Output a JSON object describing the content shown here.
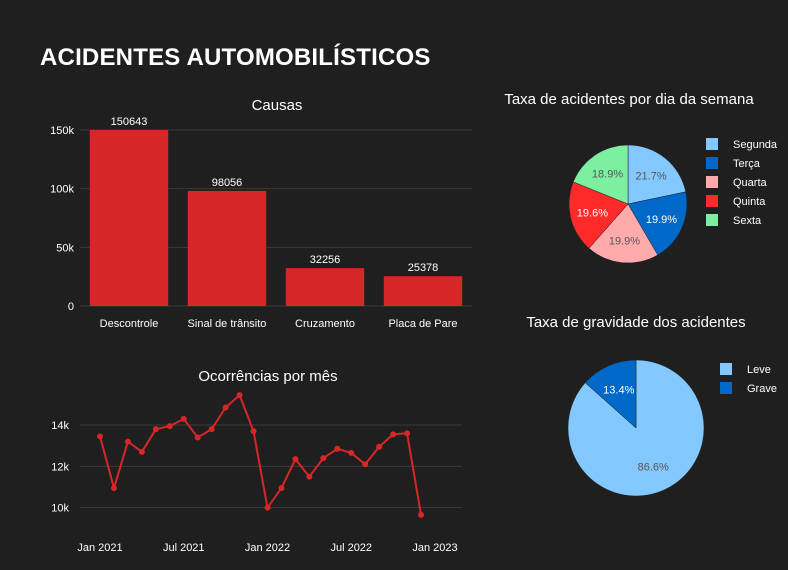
{
  "page": {
    "title": "ACIDENTES AUTOMOBILÍSTICOS"
  },
  "colors": {
    "background": "#1f1f1f",
    "bar": "#d62728",
    "line": "#d62728",
    "grid": "#3b3b3b",
    "text": "#ffffff"
  },
  "chart_data": [
    {
      "type": "bar",
      "title": "Causas",
      "categories": [
        "Descontrole",
        "Sinal de trânsito",
        "Cruzamento",
        "Placa de Pare"
      ],
      "values": [
        150643,
        98056,
        32256,
        25378
      ],
      "value_labels": [
        "150643",
        "98056",
        "32256",
        "25378"
      ],
      "ylim": [
        0,
        150000
      ],
      "yticks": [
        0,
        50000,
        100000,
        150000
      ],
      "ytick_labels": [
        "0",
        "50k",
        "100k",
        "150k"
      ],
      "grid": true
    },
    {
      "type": "line",
      "title": "Ocorrências por mês",
      "x": [
        "2021-01",
        "2021-02",
        "2021-03",
        "2021-04",
        "2021-05",
        "2021-06",
        "2021-07",
        "2021-08",
        "2021-09",
        "2021-10",
        "2021-11",
        "2021-12",
        "2022-01",
        "2022-02",
        "2022-03",
        "2022-04",
        "2022-05",
        "2022-06",
        "2022-07",
        "2022-08",
        "2022-09",
        "2022-10",
        "2022-11",
        "2022-12",
        "2023-01"
      ],
      "values": [
        13450,
        10950,
        13200,
        12700,
        13800,
        13950,
        14300,
        13400,
        13800,
        14850,
        15450,
        13700,
        10000,
        10950,
        12350,
        11500,
        12400,
        12850,
        12650,
        12100,
        12950,
        13550,
        13600,
        9650
      ],
      "xtick_labels": [
        "Jan 2021",
        "Jul 2021",
        "Jan 2022",
        "Jul 2022",
        "Jan 2023"
      ],
      "xticks": [
        "2021-01",
        "2021-07",
        "2022-01",
        "2022-07",
        "2023-01"
      ],
      "ylim": [
        9500,
        15600
      ],
      "yticks": [
        10000,
        12000,
        14000
      ],
      "ytick_labels": [
        "10k",
        "12k",
        "14k"
      ],
      "grid": true
    },
    {
      "type": "pie",
      "title": "Taxa de acidentes por dia da semana",
      "labels": [
        "Segunda",
        "Terça",
        "Quarta",
        "Quinta",
        "Sexta"
      ],
      "values": [
        21.7,
        19.9,
        19.9,
        19.6,
        18.9
      ],
      "value_labels": [
        "21.7%",
        "19.9%",
        "19.9%",
        "19.6%",
        "18.9%"
      ],
      "colors": [
        "#83c9ff",
        "#0068c9",
        "#ffabab",
        "#ff2b2b",
        "#7defa1"
      ],
      "label_colors": [
        "#555555",
        "#ffffff",
        "#555555",
        "#ffffff",
        "#555555"
      ],
      "legend": "right"
    },
    {
      "type": "pie",
      "title": "Taxa de gravidade dos acidentes",
      "labels": [
        "Leve",
        "Grave"
      ],
      "values": [
        86.6,
        13.4
      ],
      "value_labels": [
        "86.6%",
        "13.4%"
      ],
      "colors": [
        "#83c9ff",
        "#0068c9"
      ],
      "label_colors": [
        "#555555",
        "#ffffff"
      ],
      "legend": "right"
    }
  ]
}
